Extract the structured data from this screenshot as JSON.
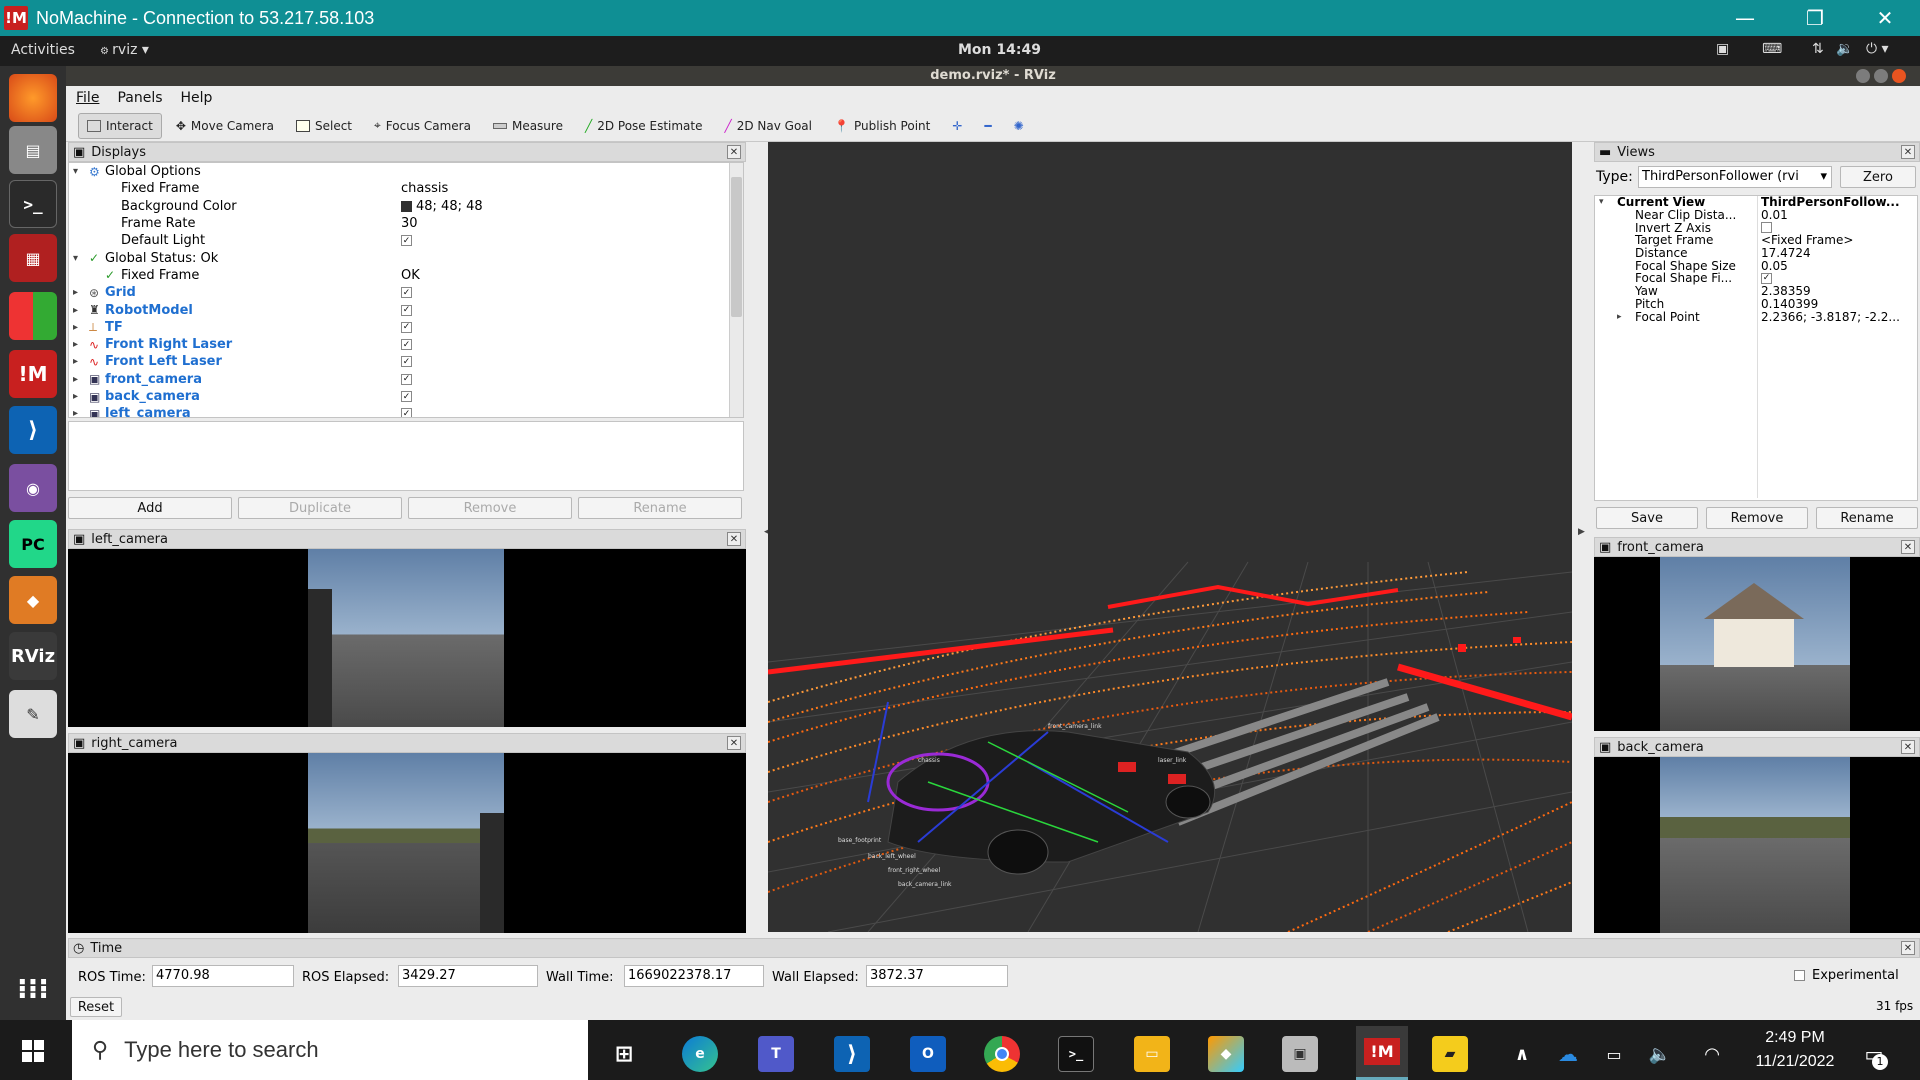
{
  "nomachine": {
    "title": "NoMachine - Connection to 53.217.58.103",
    "logo": "!M"
  },
  "gnome": {
    "activities": "Activities",
    "app": "rviz",
    "clock": "Mon 14:49"
  },
  "window": {
    "title": "demo.rviz* - RViz"
  },
  "menu": [
    "File",
    "Panels",
    "Help"
  ],
  "toolbar": {
    "interact": "Interact",
    "move_camera": "Move Camera",
    "select": "Select",
    "focus_camera": "Focus Camera",
    "measure": "Measure",
    "pose_estimate": "2D Pose Estimate",
    "nav_goal": "2D Nav Goal",
    "publish_point": "Publish Point"
  },
  "displays": {
    "title": "Displays",
    "rows": [
      {
        "label": "Global Options",
        "value": ""
      },
      {
        "label": "Fixed Frame",
        "value": "chassis"
      },
      {
        "label": "Background Color",
        "value": "48; 48; 48"
      },
      {
        "label": "Frame Rate",
        "value": "30"
      },
      {
        "label": "Default Light",
        "value": ""
      },
      {
        "label": "Global Status: Ok",
        "value": ""
      },
      {
        "label": "Fixed Frame",
        "value": "OK"
      },
      {
        "label": "Grid",
        "value": ""
      },
      {
        "label": "RobotModel",
        "value": ""
      },
      {
        "label": "TF",
        "value": ""
      },
      {
        "label": "Front Right Laser",
        "value": ""
      },
      {
        "label": "Front Left Laser",
        "value": ""
      },
      {
        "label": "front_camera",
        "value": ""
      },
      {
        "label": "back_camera",
        "value": ""
      },
      {
        "label": "left_camera",
        "value": ""
      }
    ],
    "buttons": {
      "add": "Add",
      "duplicate": "Duplicate",
      "remove": "Remove",
      "rename": "Rename"
    }
  },
  "cameras": {
    "left": "left_camera",
    "right": "right_camera",
    "front": "front_camera",
    "back": "back_camera"
  },
  "views": {
    "title": "Views",
    "type_label": "Type:",
    "type_value": "ThirdPersonFollower (rvi",
    "zero": "Zero",
    "rows": [
      {
        "label": "Current View",
        "value": "ThirdPersonFollow..."
      },
      {
        "label": "Near Clip Dista...",
        "value": "0.01"
      },
      {
        "label": "Invert Z Axis",
        "value": ""
      },
      {
        "label": "Target Frame",
        "value": "<Fixed Frame>"
      },
      {
        "label": "Distance",
        "value": "17.4724"
      },
      {
        "label": "Focal Shape Size",
        "value": "0.05"
      },
      {
        "label": "Focal Shape Fi...",
        "value": ""
      },
      {
        "label": "Yaw",
        "value": "2.38359"
      },
      {
        "label": "Pitch",
        "value": "0.140399"
      },
      {
        "label": "Focal Point",
        "value": "2.2366; -3.8187; -2.2..."
      }
    ],
    "buttons": {
      "save": "Save",
      "remove": "Remove",
      "rename": "Rename"
    }
  },
  "time": {
    "title": "Time",
    "ros_time_label": "ROS Time:",
    "ros_time": "4770.98",
    "ros_elapsed_label": "ROS Elapsed:",
    "ros_elapsed": "3429.27",
    "wall_time_label": "Wall Time:",
    "wall_time": "1669022378.17",
    "wall_elapsed_label": "Wall Elapsed:",
    "wall_elapsed": "3872.37",
    "experimental": "Experimental",
    "reset": "Reset",
    "fps": "31 fps"
  },
  "taskbar": {
    "search_placeholder": "Type here to search",
    "time": "2:49 PM",
    "date": "11/21/2022",
    "notif_count": "1"
  },
  "colors": {
    "teal": "#0f8f94",
    "laser_red": "#ff1a1a",
    "laser_orange": "#ff7a1a",
    "viewport_bg": "#303030"
  }
}
